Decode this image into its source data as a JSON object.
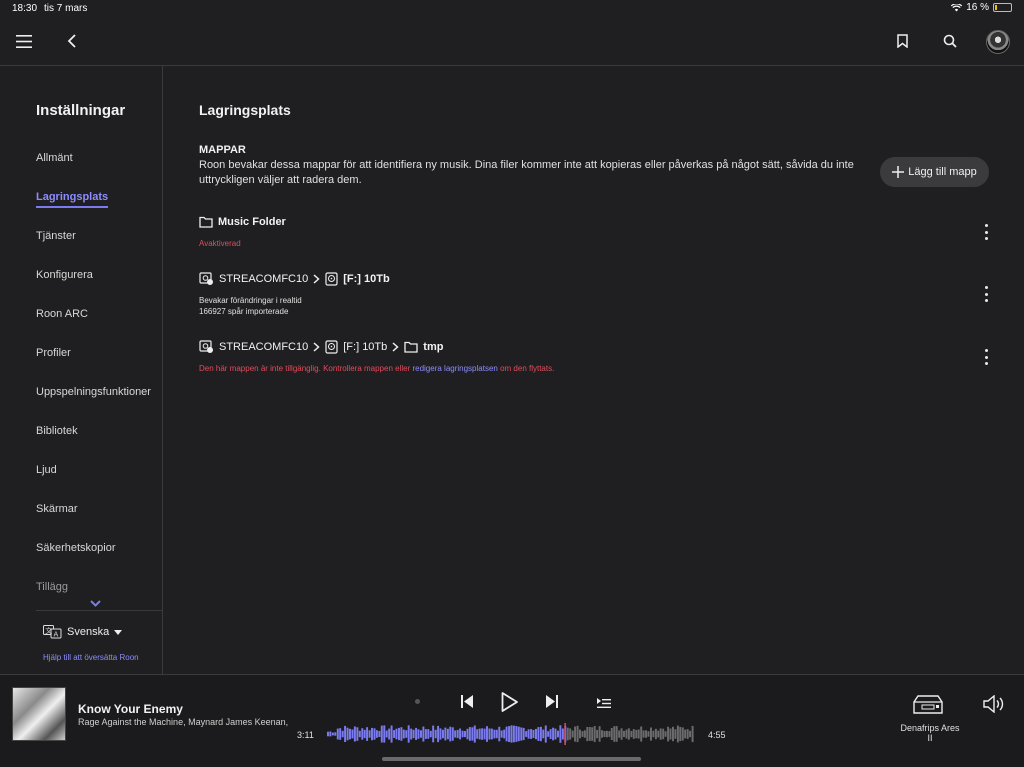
{
  "status": {
    "time": "18:30",
    "date": "tis 7 mars",
    "battery": "16 %",
    "battery_level": 0.16
  },
  "topbar": {
    "menu_icon": "hamburger-icon",
    "back_icon": "chevron-left-icon",
    "bookmark_icon": "bookmark-icon",
    "search_icon": "search-icon",
    "profile_icon": "avatar"
  },
  "sidebar": {
    "title": "Inställningar",
    "items": [
      {
        "label": "Allmänt"
      },
      {
        "label": "Lagringsplats"
      },
      {
        "label": "Tjänster"
      },
      {
        "label": "Konfigurera"
      },
      {
        "label": "Roon ARC"
      },
      {
        "label": "Profiler"
      },
      {
        "label": "Uppspelningsfunktioner"
      },
      {
        "label": "Bibliotek"
      },
      {
        "label": "Ljud"
      },
      {
        "label": "Skärmar"
      },
      {
        "label": "Säkerhetskopior"
      },
      {
        "label": "Tillägg"
      }
    ],
    "active_item": "Lagringsplats",
    "language": "Svenska",
    "translate_link": "Hjälp till att översätta Roon"
  },
  "main": {
    "title": "Lagringsplats",
    "section_heading": "MAPPAR",
    "description": "Roon bevakar dessa mappar för att identifiera ny musik. Dina filer kommer inte att kopieras eller påverkas på något sätt, såvida du inte uttryckligen väljer att radera dem.",
    "add_button": "Lägg till mapp",
    "folders": [
      {
        "name": "Music Folder",
        "status": "Avaktiverad"
      },
      {
        "device": "STREACOMFC10",
        "drive": "[F:] 10Tb",
        "line1": "Bevakar förändringar i realtid",
        "line2": "166927 spår importerade"
      },
      {
        "device": "STREACOMFC10",
        "drive": "[F:] 10Tb",
        "folder": "tmp",
        "error_prefix": "Den här mappen är inte tillgänglig. Kontrollera mappen eller ",
        "error_link": "redigera lagringsplatsen",
        "error_suffix": " om den flyttats."
      }
    ]
  },
  "player": {
    "title": "Know Your Enemy",
    "artist": "Rage Against the Machine, Maynard James Keenan,",
    "elapsed": "3:11",
    "duration": "4:55",
    "progress": 0.647,
    "zone": "Denafrips Ares",
    "zone_sub": "II",
    "accent": "#7b7bf0",
    "error_color": "#e34b5c"
  }
}
